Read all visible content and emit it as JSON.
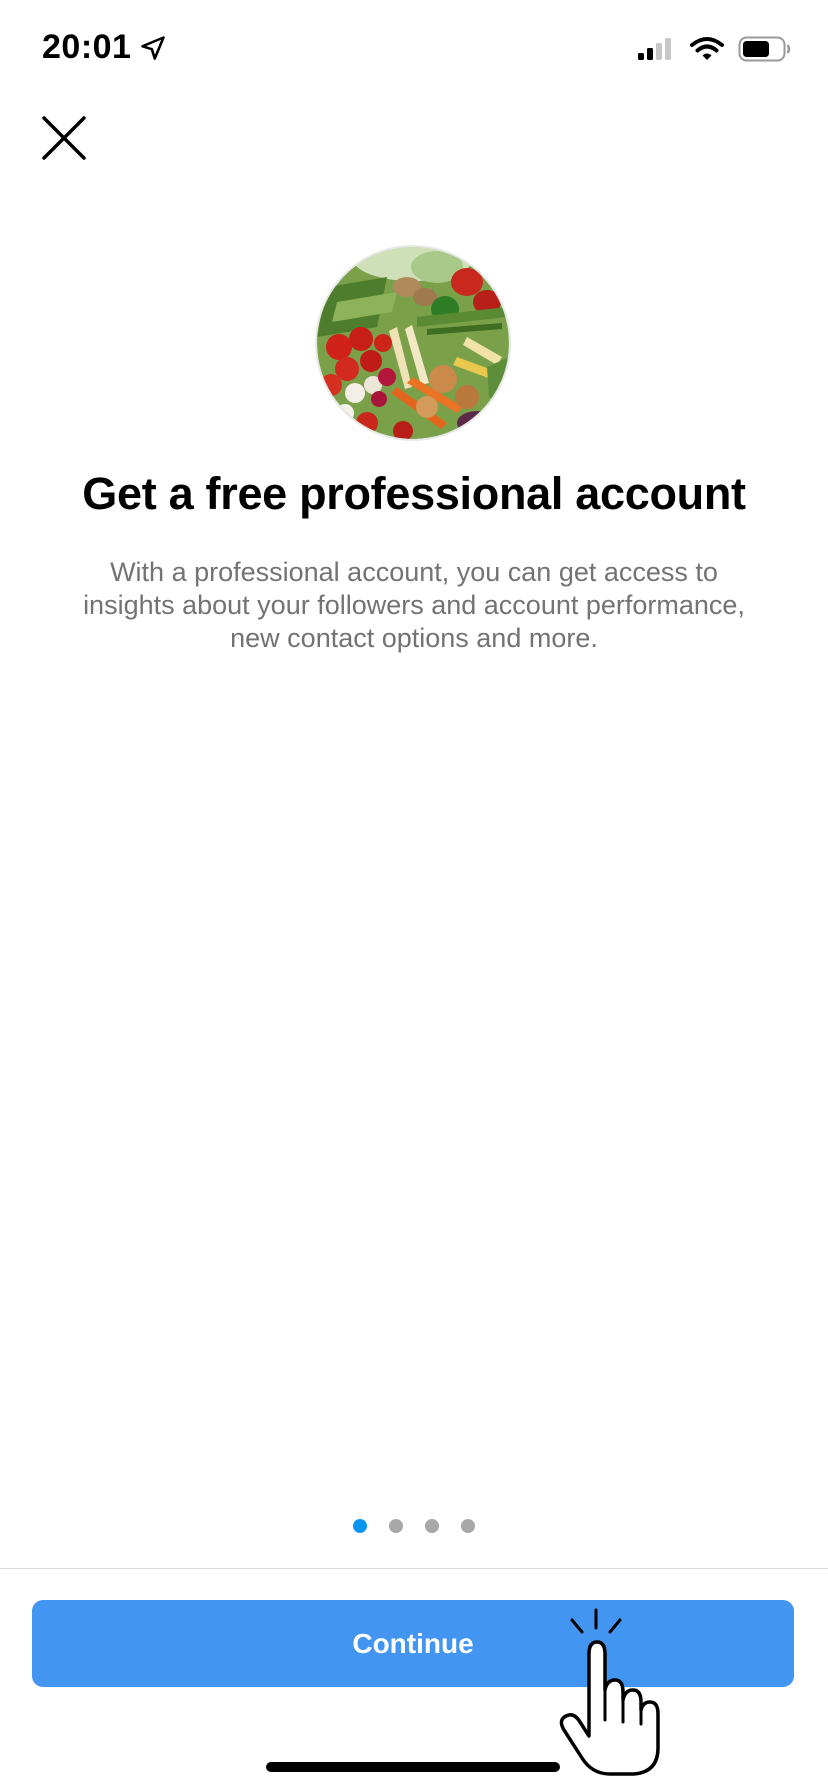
{
  "status_bar": {
    "time": "20:01",
    "icons": [
      "location-arrow-icon",
      "cellular-signal-icon",
      "wifi-icon",
      "battery-icon"
    ]
  },
  "close_icon": "close-icon",
  "hero_image": "vegetables-photo",
  "title": "Get a free professional account",
  "description": "With a professional account, you can get access to insights about your followers and account performance, new contact options and more.",
  "pagination": {
    "total": 4,
    "active_index": 0
  },
  "continue_label": "Continue",
  "colors": {
    "primary_button": "#4295f1",
    "active_dot": "#0a95f0",
    "inactive_dot": "#a8a8a8",
    "description_text": "#737373"
  }
}
